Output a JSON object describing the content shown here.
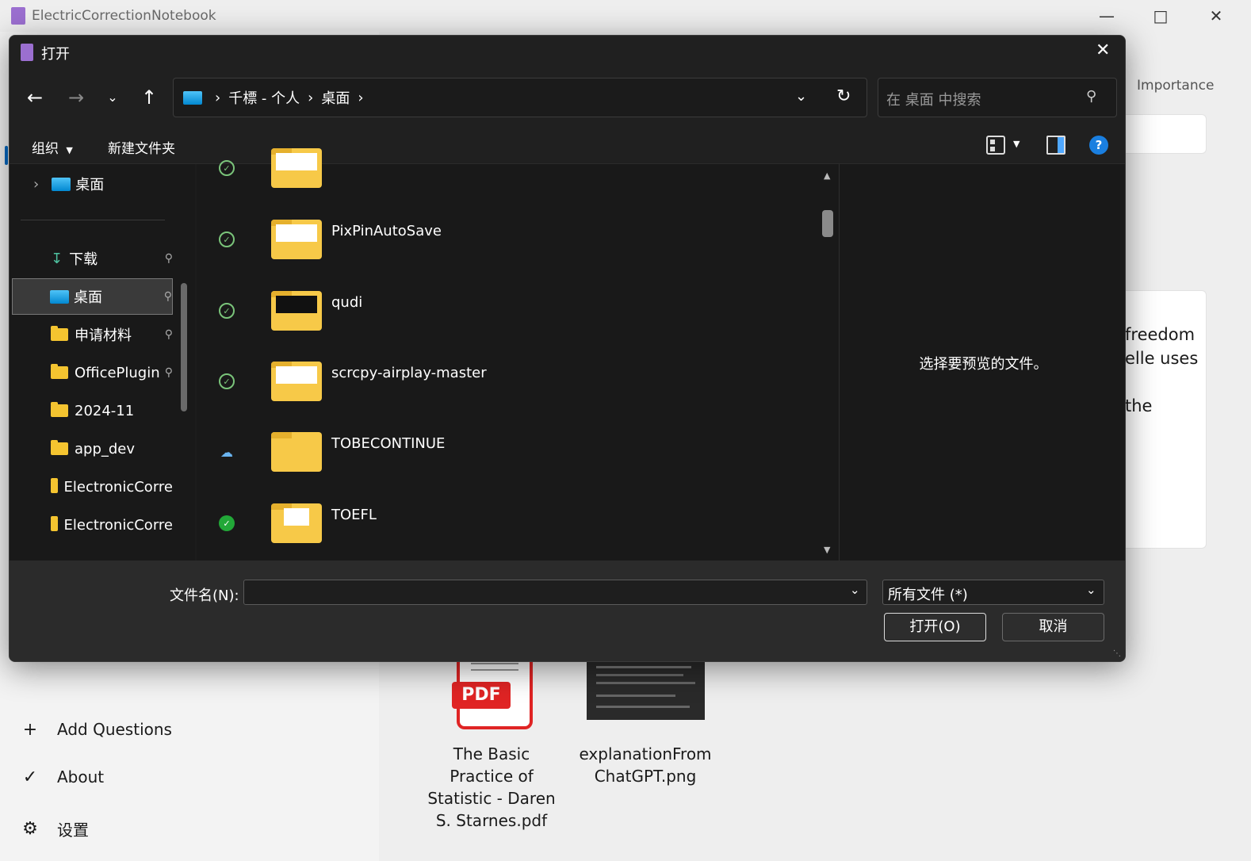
{
  "app": {
    "title": "ElectricCorrectionNotebook",
    "importance_label": "Importance",
    "bg_text": [
      "freedom",
      "elle uses",
      "the"
    ],
    "nav": [
      {
        "icon": "plus-icon",
        "glyph": "+",
        "label": "Add Questions"
      },
      {
        "icon": "check-icon",
        "glyph": "✓",
        "label": "About"
      },
      {
        "icon": "gear-icon",
        "glyph": "⚙",
        "label": "设置"
      }
    ],
    "files": [
      {
        "name": "The Basic Practice of Statistic - Daren S. Starnes.pdf",
        "badge": "PDF"
      },
      {
        "name": "explanationFromChatGPT.png"
      }
    ]
  },
  "dialog": {
    "title": "打开",
    "breadcrumb": [
      "千標 - 个人",
      "桌面"
    ],
    "search_placeholder": "在 桌面 中搜索",
    "toolbar": {
      "organize": "组织",
      "new_folder": "新建文件夹",
      "help": "?"
    },
    "tree": [
      {
        "label": "桌面",
        "type": "desktop",
        "expand": true
      },
      {
        "label": "下载",
        "type": "download",
        "pinned": true
      },
      {
        "label": "桌面",
        "type": "desktop",
        "pinned": true,
        "selected": true
      },
      {
        "label": "申请材料",
        "type": "folder",
        "pinned": true
      },
      {
        "label": "OfficePlugin",
        "type": "folder",
        "pinned": true
      },
      {
        "label": "2024-11",
        "type": "folder"
      },
      {
        "label": "app_dev",
        "type": "folder"
      },
      {
        "label": "ElectronicCorre",
        "type": "folder"
      },
      {
        "label": "ElectronicCorre",
        "type": "folder"
      }
    ],
    "items": [
      {
        "name": "",
        "status": "synced"
      },
      {
        "name": "PixPinAutoSave",
        "status": "synced"
      },
      {
        "name": "qudi",
        "status": "synced"
      },
      {
        "name": "scrcpy-airplay-master",
        "status": "synced"
      },
      {
        "name": "TOBECONTINUE",
        "status": "cloud"
      },
      {
        "name": "TOEFL",
        "status": "available"
      }
    ],
    "preview_text": "选择要预览的文件。",
    "filename_label": "文件名(N):",
    "filename_value": "",
    "filetype": "所有文件 (*)",
    "open_label": "打开(O)",
    "cancel_label": "取消"
  }
}
